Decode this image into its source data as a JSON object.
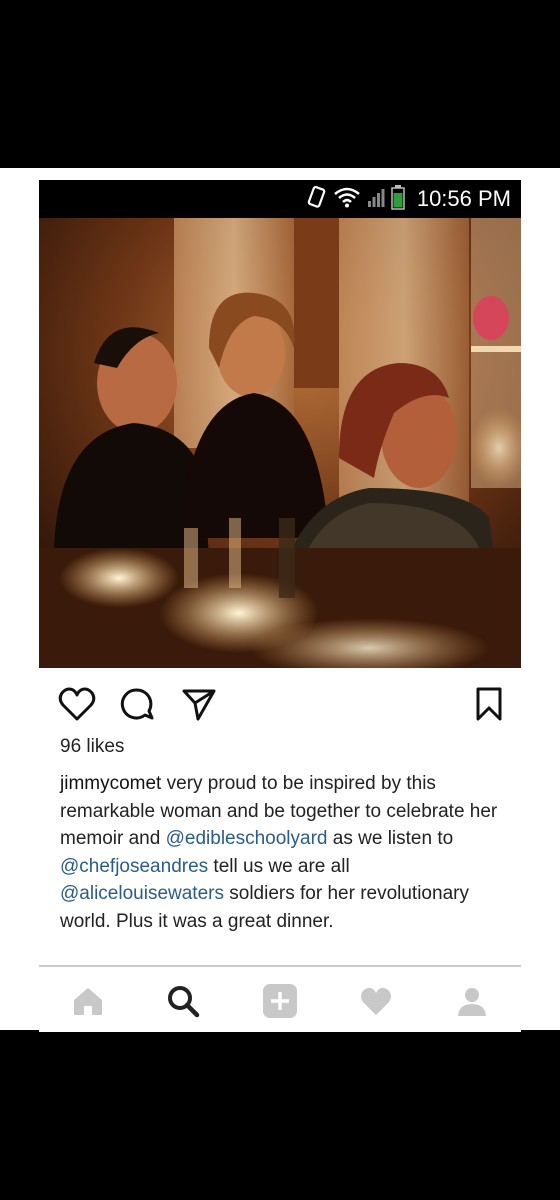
{
  "status_bar": {
    "time": "10:56 PM",
    "icons": [
      "rotate-icon",
      "wifi-icon",
      "signal-icon",
      "battery-icon"
    ]
  },
  "post": {
    "image_alt": "dinner-photo",
    "likes": "96 likes",
    "username": "jimmycomet",
    "caption_segments": [
      {
        "type": "text",
        "text": " very proud to be inspired by this remarkable woman and be together to celebrate her memoir and "
      },
      {
        "type": "mention",
        "text": "@edibleschoolyard"
      },
      {
        "type": "text",
        "text": " as we listen to "
      },
      {
        "type": "mention",
        "text": "@chefjoseandres"
      },
      {
        "type": "text",
        "text": " tell us we are all "
      },
      {
        "type": "mention",
        "text": "@alicelouisewaters"
      },
      {
        "type": "text",
        "text": " soldiers for her revolutionary world.  Plus it was a great dinner."
      }
    ]
  },
  "actions": [
    "heart-icon",
    "comment-icon",
    "share-icon",
    "bookmark-icon"
  ],
  "bottom_nav": [
    "home-icon",
    "search-icon",
    "add-post-icon",
    "activity-heart-icon",
    "profile-icon"
  ],
  "colors": {
    "mention": "#2a5c8a",
    "nav_inactive": "#c8c8c8",
    "nav_active": "#222222"
  }
}
